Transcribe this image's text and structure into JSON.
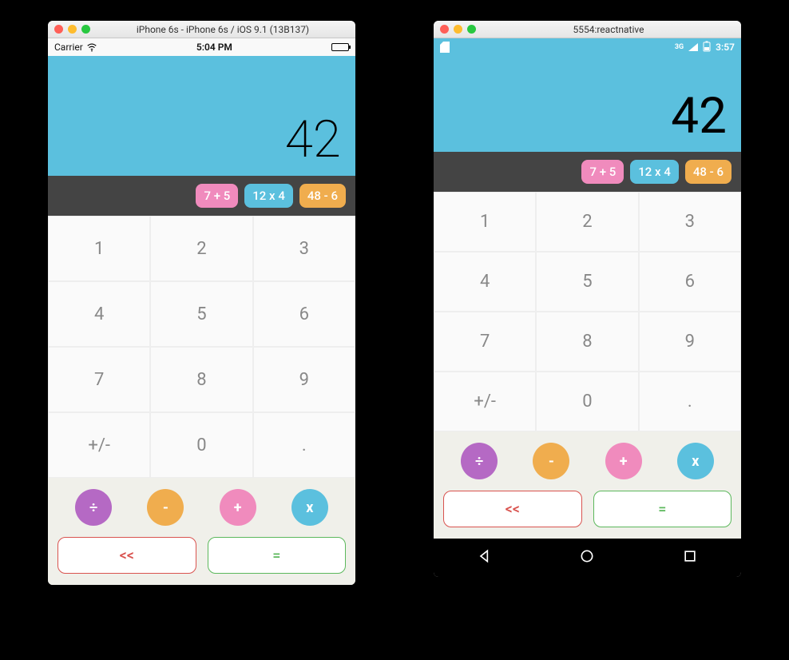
{
  "ios": {
    "window_title": "iPhone 6s - iPhone 6s / iOS 9.1 (13B137)",
    "status": {
      "carrier": "Carrier",
      "time": "5:04 PM"
    },
    "display": "42",
    "history": [
      "7 + 5",
      "12 x 4",
      "48 - 6"
    ],
    "numkeys": [
      "1",
      "2",
      "3",
      "4",
      "5",
      "6",
      "7",
      "8",
      "9",
      "+/-",
      "0",
      "."
    ],
    "ops": {
      "div": "÷",
      "sub": "-",
      "add": "+",
      "mul": "x"
    },
    "back": "<<",
    "eq": "="
  },
  "android": {
    "window_title": "5554:reactnative",
    "status": {
      "net": "3G",
      "time": "3:57"
    },
    "display": "42",
    "history": [
      "7 + 5",
      "12 x 4",
      "48 - 6"
    ],
    "numkeys": [
      "1",
      "2",
      "3",
      "4",
      "5",
      "6",
      "7",
      "8",
      "9",
      "+/-",
      "0",
      "."
    ],
    "ops": {
      "div": "÷",
      "sub": "-",
      "add": "+",
      "mul": "x"
    },
    "back": "<<",
    "eq": "="
  }
}
